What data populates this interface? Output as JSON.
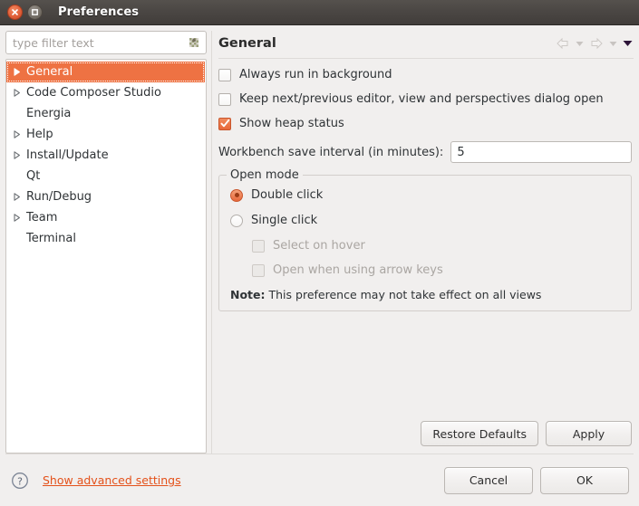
{
  "window": {
    "title": "Preferences",
    "close_icon": "close-icon",
    "maximize_icon": "maximize-icon"
  },
  "sidebar": {
    "filter": {
      "placeholder": "type filter text",
      "value": "",
      "icon": "filter-clear-icon"
    },
    "items": [
      {
        "label": "General",
        "expandable": true,
        "selected": true
      },
      {
        "label": "Code Composer Studio",
        "expandable": true,
        "selected": false
      },
      {
        "label": "Energia",
        "expandable": false,
        "selected": false
      },
      {
        "label": "Help",
        "expandable": true,
        "selected": false
      },
      {
        "label": "Install/Update",
        "expandable": true,
        "selected": false
      },
      {
        "label": "Qt",
        "expandable": false,
        "selected": false
      },
      {
        "label": "Run/Debug",
        "expandable": true,
        "selected": false
      },
      {
        "label": "Team",
        "expandable": true,
        "selected": false
      },
      {
        "label": "Terminal",
        "expandable": false,
        "selected": false
      }
    ]
  },
  "page": {
    "title": "General",
    "nav": {
      "back_icon": "back-arrow-icon",
      "back_menu_icon": "chevron-down-icon",
      "forward_icon": "forward-arrow-icon",
      "forward_menu_icon": "chevron-down-icon",
      "view_menu_icon": "view-menu-icon"
    },
    "checkboxes": [
      {
        "label": "Always run in background",
        "checked": false,
        "disabled": false
      },
      {
        "label": "Keep next/previous editor, view and perspectives dialog open",
        "checked": false,
        "disabled": false
      },
      {
        "label": "Show heap status",
        "checked": true,
        "disabled": false
      }
    ],
    "save_interval": {
      "label": "Workbench save interval (in minutes):",
      "value": "5"
    },
    "open_mode": {
      "legend": "Open mode",
      "radios": [
        {
          "label": "Double click",
          "checked": true
        },
        {
          "label": "Single click",
          "checked": false
        }
      ],
      "sub_checkboxes": [
        {
          "label": "Select on hover",
          "checked": false,
          "disabled": true
        },
        {
          "label": "Open when using arrow keys",
          "checked": false,
          "disabled": true
        }
      ],
      "note_prefix": "Note:",
      "note_text": "This preference may not take effect on all views"
    },
    "buttons": {
      "restore_defaults": "Restore Defaults",
      "apply": "Apply"
    }
  },
  "footer": {
    "help_icon": "help-icon",
    "advanced_link": "Show advanced settings",
    "cancel": "Cancel",
    "ok": "OK"
  },
  "colors": {
    "accent_orange": "#ee7243",
    "link_orange": "#e4511a",
    "titlebar_dark": "#4b4744",
    "panel_bg": "#f1efee"
  }
}
